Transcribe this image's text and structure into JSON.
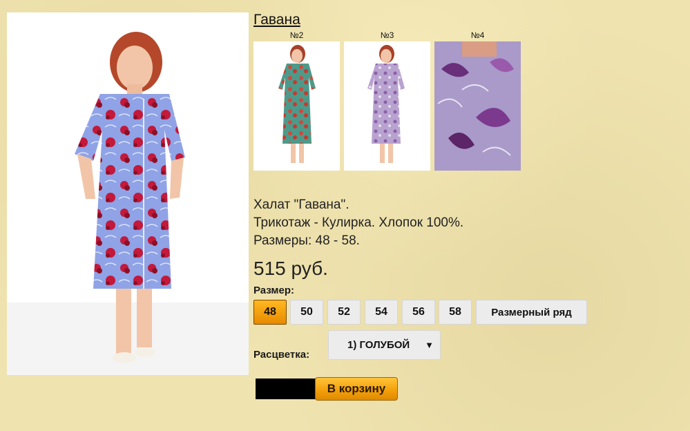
{
  "product": {
    "title": "Гавана",
    "thumbnails": [
      {
        "label": "№2"
      },
      {
        "label": "№3"
      },
      {
        "label": "№4"
      }
    ],
    "description": [
      "Халат \"Гавана\".",
      "Трикотаж - Кулирка. Хлопок 100%.",
      "Размеры: 48 - 58."
    ],
    "price": "515 руб."
  },
  "size": {
    "label": "Размер:",
    "options": [
      "48",
      "50",
      "52",
      "54",
      "56",
      "58"
    ],
    "selected": "48",
    "chart_label": "Размерный ряд"
  },
  "color": {
    "label": "Расцветка:",
    "selected": "1) ГОЛУБОЙ"
  },
  "cart": {
    "quantity": "",
    "button_label": "В корзину"
  },
  "colors": {
    "background": "#efe3b0",
    "selected_size": "#f4a10c",
    "button_gray": "#ececec"
  }
}
